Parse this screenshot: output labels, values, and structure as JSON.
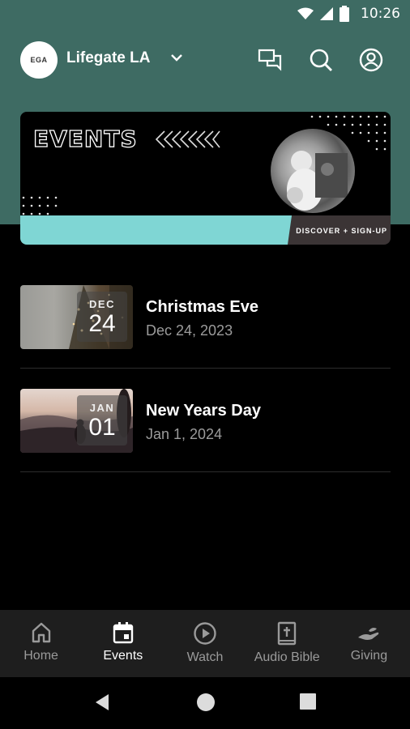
{
  "status_bar": {
    "time": "10:26"
  },
  "app_bar": {
    "logo_text": "EGA",
    "org_name": "Lifegate LA"
  },
  "banner": {
    "title": "EVENTS",
    "cta": "DISCOVER + SIGN-UP"
  },
  "events": [
    {
      "month": "DEC",
      "day": "24",
      "title": "Christmas Eve",
      "date": "Dec 24, 2023"
    },
    {
      "month": "JAN",
      "day": "01",
      "title": "New Years Day",
      "date": "Jan 1, 2024"
    }
  ],
  "bottom_nav": [
    {
      "label": "Home",
      "icon": "home-icon",
      "active": false
    },
    {
      "label": "Events",
      "icon": "calendar-icon",
      "active": true
    },
    {
      "label": "Watch",
      "icon": "play-icon",
      "active": false
    },
    {
      "label": "Audio Bible",
      "icon": "bible-icon",
      "active": false
    },
    {
      "label": "Giving",
      "icon": "giving-icon",
      "active": false
    }
  ],
  "colors": {
    "header": "#3e6b63",
    "accent_stripe": "#7fd6d4",
    "background": "#000000",
    "nav_bar": "#1e1e1e"
  }
}
